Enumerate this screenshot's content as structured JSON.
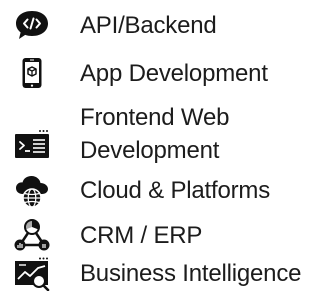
{
  "menu": {
    "items": [
      {
        "label": "API/Backend",
        "icon": "code-bubble-icon"
      },
      {
        "label": "App Development",
        "icon": "mobile-box-icon"
      },
      {
        "label": "Frontend Web Development",
        "icon": "terminal-window-icon"
      },
      {
        "label": "Cloud & Platforms",
        "icon": "cloud-globe-icon"
      },
      {
        "label": "CRM / ERP",
        "icon": "network-nodes-icon"
      },
      {
        "label": "Business Intelligence",
        "icon": "chart-search-icon"
      }
    ]
  },
  "colors": {
    "text": "#1c1c1c",
    "icon": "#111111",
    "background": "#ffffff"
  }
}
